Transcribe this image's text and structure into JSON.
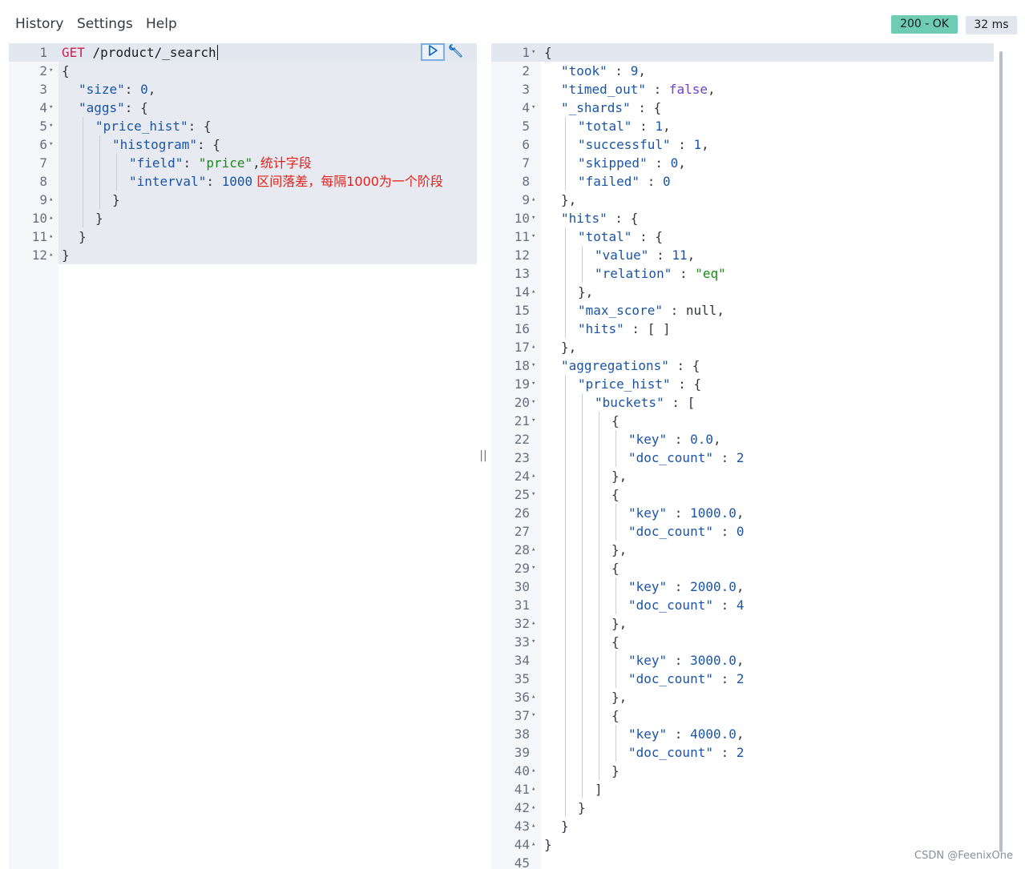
{
  "menu": {
    "history": "History",
    "settings": "Settings",
    "help": "Help"
  },
  "status": {
    "code": "200 - OK",
    "time": "32 ms",
    "ok_color": "#6dccb1"
  },
  "request": {
    "lines": [
      {
        "n": "1",
        "fold": "",
        "ind": 0,
        "t": [
          [
            "t-method",
            "GET"
          ],
          [
            "t-url",
            " /product/_search"
          ]
        ]
      },
      {
        "n": "2",
        "fold": "▾",
        "ind": 0,
        "t": [
          [
            "t-punc",
            "{"
          ]
        ]
      },
      {
        "n": "3",
        "fold": "",
        "ind": 1,
        "t": [
          [
            "t-key",
            "\"size\""
          ],
          [
            "t-punc",
            ": "
          ],
          [
            "t-num",
            "0"
          ],
          [
            "t-punc",
            ","
          ]
        ]
      },
      {
        "n": "4",
        "fold": "▾",
        "ind": 1,
        "t": [
          [
            "t-key",
            "\"aggs\""
          ],
          [
            "t-punc",
            ": {"
          ]
        ]
      },
      {
        "n": "5",
        "fold": "▾",
        "ind": 2,
        "t": [
          [
            "t-key",
            "\"price_hist\""
          ],
          [
            "t-punc",
            ": {"
          ]
        ]
      },
      {
        "n": "6",
        "fold": "▾",
        "ind": 3,
        "t": [
          [
            "t-key",
            "\"histogram\""
          ],
          [
            "t-punc",
            ": {"
          ]
        ]
      },
      {
        "n": "7",
        "fold": "",
        "ind": 4,
        "t": [
          [
            "t-key",
            "\"field\""
          ],
          [
            "t-punc",
            ": "
          ],
          [
            "t-str",
            "\"price\""
          ],
          [
            "t-punc",
            ","
          ],
          [
            "t-note",
            "统计字段"
          ]
        ]
      },
      {
        "n": "8",
        "fold": "",
        "ind": 4,
        "t": [
          [
            "t-key",
            "\"interval\""
          ],
          [
            "t-punc",
            ": "
          ],
          [
            "t-num",
            "1000"
          ],
          [
            "t-note",
            " 区间落差，每隔1000为一个阶段"
          ]
        ]
      },
      {
        "n": "9",
        "fold": "▴",
        "ind": 3,
        "t": [
          [
            "t-punc",
            "}"
          ]
        ]
      },
      {
        "n": "10",
        "fold": "▴",
        "ind": 2,
        "t": [
          [
            "t-punc",
            "}"
          ]
        ]
      },
      {
        "n": "11",
        "fold": "▴",
        "ind": 1,
        "t": [
          [
            "t-punc",
            "}"
          ]
        ]
      },
      {
        "n": "12",
        "fold": "▴",
        "ind": 0,
        "t": [
          [
            "t-punc",
            "}"
          ]
        ]
      }
    ]
  },
  "response": {
    "lines": [
      {
        "n": "1",
        "fold": "▾",
        "ind": 0,
        "t": [
          [
            "t-punc",
            "{"
          ]
        ]
      },
      {
        "n": "2",
        "fold": "",
        "ind": 1,
        "t": [
          [
            "t-key",
            "\"took\""
          ],
          [
            "t-punc",
            " : "
          ],
          [
            "t-num",
            "9"
          ],
          [
            "t-punc",
            ","
          ]
        ]
      },
      {
        "n": "3",
        "fold": "",
        "ind": 1,
        "t": [
          [
            "t-key",
            "\"timed_out\""
          ],
          [
            "t-punc",
            " : "
          ],
          [
            "t-bool",
            "false"
          ],
          [
            "t-punc",
            ","
          ]
        ]
      },
      {
        "n": "4",
        "fold": "▾",
        "ind": 1,
        "t": [
          [
            "t-key",
            "\"_shards\""
          ],
          [
            "t-punc",
            " : {"
          ]
        ]
      },
      {
        "n": "5",
        "fold": "",
        "ind": 2,
        "t": [
          [
            "t-key",
            "\"total\""
          ],
          [
            "t-punc",
            " : "
          ],
          [
            "t-num",
            "1"
          ],
          [
            "t-punc",
            ","
          ]
        ]
      },
      {
        "n": "6",
        "fold": "",
        "ind": 2,
        "t": [
          [
            "t-key",
            "\"successful\""
          ],
          [
            "t-punc",
            " : "
          ],
          [
            "t-num",
            "1"
          ],
          [
            "t-punc",
            ","
          ]
        ]
      },
      {
        "n": "7",
        "fold": "",
        "ind": 2,
        "t": [
          [
            "t-key",
            "\"skipped\""
          ],
          [
            "t-punc",
            " : "
          ],
          [
            "t-num",
            "0"
          ],
          [
            "t-punc",
            ","
          ]
        ]
      },
      {
        "n": "8",
        "fold": "",
        "ind": 2,
        "t": [
          [
            "t-key",
            "\"failed\""
          ],
          [
            "t-punc",
            " : "
          ],
          [
            "t-num",
            "0"
          ]
        ]
      },
      {
        "n": "9",
        "fold": "▴",
        "ind": 1,
        "t": [
          [
            "t-punc",
            "},"
          ]
        ]
      },
      {
        "n": "10",
        "fold": "▾",
        "ind": 1,
        "t": [
          [
            "t-key",
            "\"hits\""
          ],
          [
            "t-punc",
            " : {"
          ]
        ]
      },
      {
        "n": "11",
        "fold": "▾",
        "ind": 2,
        "t": [
          [
            "t-key",
            "\"total\""
          ],
          [
            "t-punc",
            " : {"
          ]
        ]
      },
      {
        "n": "12",
        "fold": "",
        "ind": 3,
        "t": [
          [
            "t-key",
            "\"value\""
          ],
          [
            "t-punc",
            " : "
          ],
          [
            "t-num",
            "11"
          ],
          [
            "t-punc",
            ","
          ]
        ]
      },
      {
        "n": "13",
        "fold": "",
        "ind": 3,
        "t": [
          [
            "t-key",
            "\"relation\""
          ],
          [
            "t-punc",
            " : "
          ],
          [
            "t-str",
            "\"eq\""
          ]
        ]
      },
      {
        "n": "14",
        "fold": "▴",
        "ind": 2,
        "t": [
          [
            "t-punc",
            "},"
          ]
        ]
      },
      {
        "n": "15",
        "fold": "",
        "ind": 2,
        "t": [
          [
            "t-key",
            "\"max_score\""
          ],
          [
            "t-punc",
            " : "
          ],
          [
            "t-null",
            "null"
          ],
          [
            "t-punc",
            ","
          ]
        ]
      },
      {
        "n": "16",
        "fold": "",
        "ind": 2,
        "t": [
          [
            "t-key",
            "\"hits\""
          ],
          [
            "t-punc",
            " : [ ]"
          ]
        ]
      },
      {
        "n": "17",
        "fold": "▴",
        "ind": 1,
        "t": [
          [
            "t-punc",
            "},"
          ]
        ]
      },
      {
        "n": "18",
        "fold": "▾",
        "ind": 1,
        "t": [
          [
            "t-key",
            "\"aggregations\""
          ],
          [
            "t-punc",
            " : {"
          ]
        ]
      },
      {
        "n": "19",
        "fold": "▾",
        "ind": 2,
        "t": [
          [
            "t-key",
            "\"price_hist\""
          ],
          [
            "t-punc",
            " : {"
          ]
        ]
      },
      {
        "n": "20",
        "fold": "▾",
        "ind": 3,
        "t": [
          [
            "t-key",
            "\"buckets\""
          ],
          [
            "t-punc",
            " : ["
          ]
        ]
      },
      {
        "n": "21",
        "fold": "▾",
        "ind": 4,
        "t": [
          [
            "t-punc",
            "{"
          ]
        ]
      },
      {
        "n": "22",
        "fold": "",
        "ind": 5,
        "t": [
          [
            "t-key",
            "\"key\""
          ],
          [
            "t-punc",
            " : "
          ],
          [
            "t-num",
            "0.0"
          ],
          [
            "t-punc",
            ","
          ]
        ]
      },
      {
        "n": "23",
        "fold": "",
        "ind": 5,
        "t": [
          [
            "t-key",
            "\"doc_count\""
          ],
          [
            "t-punc",
            " : "
          ],
          [
            "t-num",
            "2"
          ]
        ]
      },
      {
        "n": "24",
        "fold": "▴",
        "ind": 4,
        "t": [
          [
            "t-punc",
            "},"
          ]
        ]
      },
      {
        "n": "25",
        "fold": "▾",
        "ind": 4,
        "t": [
          [
            "t-punc",
            "{"
          ]
        ]
      },
      {
        "n": "26",
        "fold": "",
        "ind": 5,
        "t": [
          [
            "t-key",
            "\"key\""
          ],
          [
            "t-punc",
            " : "
          ],
          [
            "t-num",
            "1000.0"
          ],
          [
            "t-punc",
            ","
          ]
        ]
      },
      {
        "n": "27",
        "fold": "",
        "ind": 5,
        "t": [
          [
            "t-key",
            "\"doc_count\""
          ],
          [
            "t-punc",
            " : "
          ],
          [
            "t-num",
            "0"
          ]
        ]
      },
      {
        "n": "28",
        "fold": "▴",
        "ind": 4,
        "t": [
          [
            "t-punc",
            "},"
          ]
        ]
      },
      {
        "n": "29",
        "fold": "▾",
        "ind": 4,
        "t": [
          [
            "t-punc",
            "{"
          ]
        ]
      },
      {
        "n": "30",
        "fold": "",
        "ind": 5,
        "t": [
          [
            "t-key",
            "\"key\""
          ],
          [
            "t-punc",
            " : "
          ],
          [
            "t-num",
            "2000.0"
          ],
          [
            "t-punc",
            ","
          ]
        ]
      },
      {
        "n": "31",
        "fold": "",
        "ind": 5,
        "t": [
          [
            "t-key",
            "\"doc_count\""
          ],
          [
            "t-punc",
            " : "
          ],
          [
            "t-num",
            "4"
          ]
        ]
      },
      {
        "n": "32",
        "fold": "▴",
        "ind": 4,
        "t": [
          [
            "t-punc",
            "},"
          ]
        ]
      },
      {
        "n": "33",
        "fold": "▾",
        "ind": 4,
        "t": [
          [
            "t-punc",
            "{"
          ]
        ]
      },
      {
        "n": "34",
        "fold": "",
        "ind": 5,
        "t": [
          [
            "t-key",
            "\"key\""
          ],
          [
            "t-punc",
            " : "
          ],
          [
            "t-num",
            "3000.0"
          ],
          [
            "t-punc",
            ","
          ]
        ]
      },
      {
        "n": "35",
        "fold": "",
        "ind": 5,
        "t": [
          [
            "t-key",
            "\"doc_count\""
          ],
          [
            "t-punc",
            " : "
          ],
          [
            "t-num",
            "2"
          ]
        ]
      },
      {
        "n": "36",
        "fold": "▴",
        "ind": 4,
        "t": [
          [
            "t-punc",
            "},"
          ]
        ]
      },
      {
        "n": "37",
        "fold": "▾",
        "ind": 4,
        "t": [
          [
            "t-punc",
            "{"
          ]
        ]
      },
      {
        "n": "38",
        "fold": "",
        "ind": 5,
        "t": [
          [
            "t-key",
            "\"key\""
          ],
          [
            "t-punc",
            " : "
          ],
          [
            "t-num",
            "4000.0"
          ],
          [
            "t-punc",
            ","
          ]
        ]
      },
      {
        "n": "39",
        "fold": "",
        "ind": 5,
        "t": [
          [
            "t-key",
            "\"doc_count\""
          ],
          [
            "t-punc",
            " : "
          ],
          [
            "t-num",
            "2"
          ]
        ]
      },
      {
        "n": "40",
        "fold": "▴",
        "ind": 4,
        "t": [
          [
            "t-punc",
            "}"
          ]
        ]
      },
      {
        "n": "41",
        "fold": "▴",
        "ind": 3,
        "t": [
          [
            "t-punc",
            "]"
          ]
        ]
      },
      {
        "n": "42",
        "fold": "▴",
        "ind": 2,
        "t": [
          [
            "t-punc",
            "}"
          ]
        ]
      },
      {
        "n": "43",
        "fold": "▴",
        "ind": 1,
        "t": [
          [
            "t-punc",
            "}"
          ]
        ]
      },
      {
        "n": "44",
        "fold": "▴",
        "ind": 0,
        "t": [
          [
            "t-punc",
            "}"
          ]
        ]
      },
      {
        "n": "45",
        "fold": "",
        "ind": 0,
        "t": []
      }
    ]
  },
  "watermark": "CSDN @FeenixOne",
  "icons": {
    "run": "play-icon",
    "settings": "wrench-icon",
    "splitter": "resize-handle-icon"
  }
}
